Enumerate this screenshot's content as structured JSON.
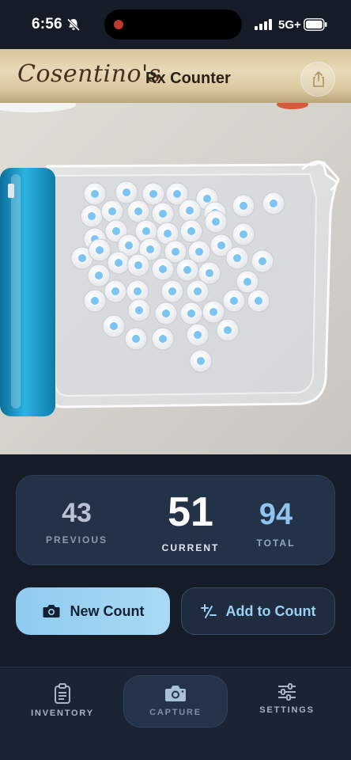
{
  "status_bar": {
    "time": "6:56",
    "network": "5G+",
    "icons": [
      "bell-off-icon",
      "signal-icon",
      "battery-icon"
    ]
  },
  "header": {
    "brand": "Cosentino's",
    "title": "Rx Counter",
    "share_icon": "share-icon"
  },
  "photo": {
    "description_icon": "camera-capture-image",
    "pill_count_marked": 51
  },
  "stats": {
    "previous": {
      "value": "43",
      "label": "PREVIOUS"
    },
    "current": {
      "value": "51",
      "label": "CURRENT"
    },
    "total": {
      "value": "94",
      "label": "TOTAL"
    }
  },
  "actions": {
    "new_count": {
      "label": "New Count",
      "icon": "camera-icon"
    },
    "add_to_count": {
      "label": "Add to Count",
      "icon": "plus-minus-icon"
    }
  },
  "tabs": [
    {
      "label": "INVENTORY",
      "icon": "clipboard-icon",
      "active": false
    },
    {
      "label": "CAPTURE",
      "icon": "camera-icon",
      "active": true
    },
    {
      "label": "SETTINGS",
      "icon": "sliders-icon",
      "active": false
    }
  ],
  "colors": {
    "background": "#151c28",
    "card": "#243248",
    "accent": "#8fcbef",
    "header_gold": "#d8c59a",
    "pill_marker": "#7cc4f2"
  }
}
